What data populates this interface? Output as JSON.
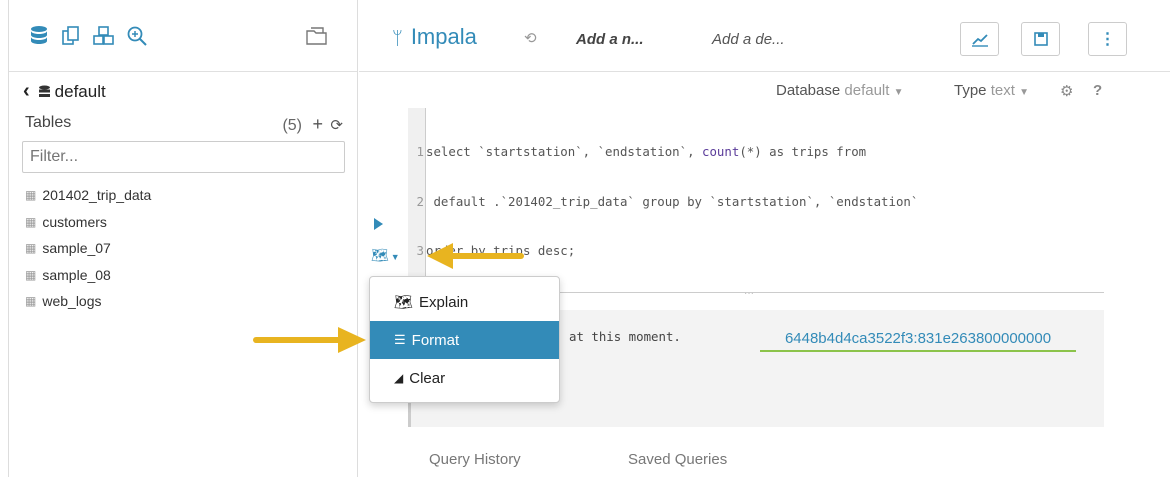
{
  "colors": {
    "accent": "#338bb8",
    "arrow": "#e8b420",
    "underline": "#8bc34a"
  },
  "assist": {
    "top_icons": [
      "database-icon",
      "documents-icon",
      "cubes-icon",
      "zoom-icon",
      "folder-open-icon"
    ],
    "db_name": "default",
    "tables_label": "Tables",
    "tables_count": "(5)",
    "filter_placeholder": "Filter...",
    "tables": [
      "201402_trip_data",
      "customers",
      "sample_07",
      "sample_08",
      "web_logs"
    ]
  },
  "header": {
    "engine": "Impala",
    "name_placeholder": "Add a n...",
    "desc_placeholder": "Add a de..."
  },
  "editor_options": {
    "database_label": "Database",
    "database_value": "default",
    "type_label": "Type",
    "type_value": "text",
    "help": "?"
  },
  "code_lines": [
    {
      "n": "1",
      "pre": "select `startstation`, `endstation`, ",
      "kw": "count",
      "post": "(*) as trips from"
    },
    {
      "n": "2",
      "pre": " default .`201402_trip_data` group by `startstation`, `endstation`",
      "kw": "",
      "post": ""
    },
    {
      "n": "3",
      "pre": "order by trips desc;",
      "kw": "",
      "post": ""
    }
  ],
  "menu": {
    "items": [
      {
        "label": "Explain",
        "icon": "map-icon",
        "active": false
      },
      {
        "label": "Format",
        "icon": "indent-icon",
        "active": true
      },
      {
        "label": "Clear",
        "icon": "eraser-icon",
        "active": false
      }
    ]
  },
  "results": {
    "message": "at this moment.",
    "query_id": "6448b4d4ca3522f3:831e263800000000"
  },
  "bottom_tabs": [
    "Query History",
    "Saved Queries"
  ]
}
